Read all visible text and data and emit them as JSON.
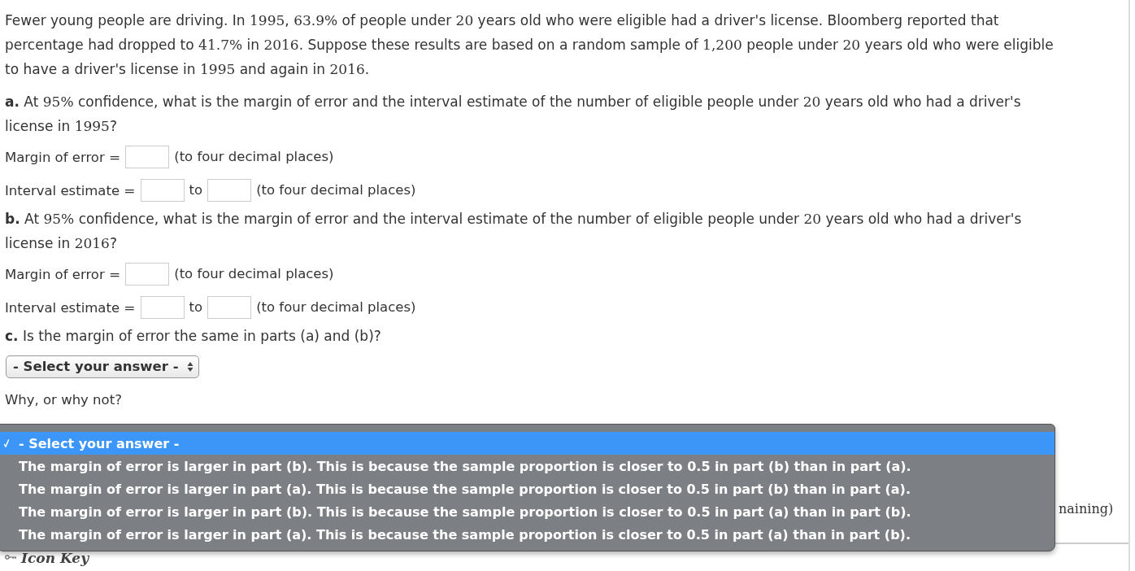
{
  "intro": [
    "Fewer young people are driving. In ",
    {
      "math": "1995"
    },
    ", ",
    {
      "math": "63.9%"
    },
    " of people under ",
    {
      "math": "20"
    },
    " years old who were eligible had a driver's license. Bloomberg reported that percentage had dropped to ",
    {
      "math": "41.7%"
    },
    " in ",
    {
      "math": "2016"
    },
    ". Suppose these results are based on a random sample of ",
    {
      "math": "1,200"
    },
    " people under ",
    {
      "math": "20"
    },
    " years old who were eligible to have a driver's license in ",
    {
      "math": "1995"
    },
    " and again in ",
    {
      "math": "2016"
    },
    "."
  ],
  "parts": [
    {
      "label": "a.",
      "question": [
        " At ",
        {
          "math": "95%"
        },
        " confidence, what is the margin of error and the interval estimate of the number of eligible people under ",
        {
          "math": "20"
        },
        " years old who had a driver's license in ",
        {
          "math": "1995"
        },
        "?"
      ],
      "fields": [
        {
          "kind": "single",
          "label": "Margin of error",
          "sign": "=",
          "hint": "(to four decimal places)"
        },
        {
          "kind": "range",
          "label": "Interval estimate",
          "sign": "=",
          "between": "to",
          "hint": "(to four decimal places)"
        }
      ]
    },
    {
      "label": "b.",
      "question": [
        " At ",
        {
          "math": "95%"
        },
        " confidence, what is the margin of error and the interval estimate of the number of eligible people under ",
        {
          "math": "20"
        },
        " years old who had a driver's license in ",
        {
          "math": "2016"
        },
        "?"
      ],
      "fields": [
        {
          "kind": "single",
          "label": "Margin of error",
          "sign": "=",
          "hint": "(to four decimal places)"
        },
        {
          "kind": "range",
          "label": "Interval estimate",
          "sign": "=",
          "between": "to",
          "hint": "(to four decimal places)"
        }
      ]
    },
    {
      "label": "c.",
      "question": [
        " Is the margin of error the same in parts (a) and (b)?"
      ],
      "fields": [
        {
          "kind": "select",
          "value": "- Select your answer -"
        },
        {
          "kind": "prompt",
          "label": "Why, or why not?"
        }
      ]
    }
  ],
  "dropdown": {
    "options": [
      {
        "text": "- Select your answer -",
        "selected": true
      },
      {
        "text": "The margin of error is larger in part (b). This is because the sample proportion is closer to 0.5 in part (b) than in part (a).",
        "selected": false
      },
      {
        "text": "The margin of error is larger in part (a). This is because the sample proportion is closer to 0.5 in part (b) than in part (a).",
        "selected": false
      },
      {
        "text": "The margin of error is larger in part (b). This is because the sample proportion is closer to 0.5 in part (a) than in part (b).",
        "selected": false
      },
      {
        "text": "The margin of error is larger in part (a). This is because the sample proportion is closer to 0.5 in part (a) than in part (b).",
        "selected": false
      }
    ]
  },
  "side_text": "naining)",
  "icon_key": "Icon Key"
}
